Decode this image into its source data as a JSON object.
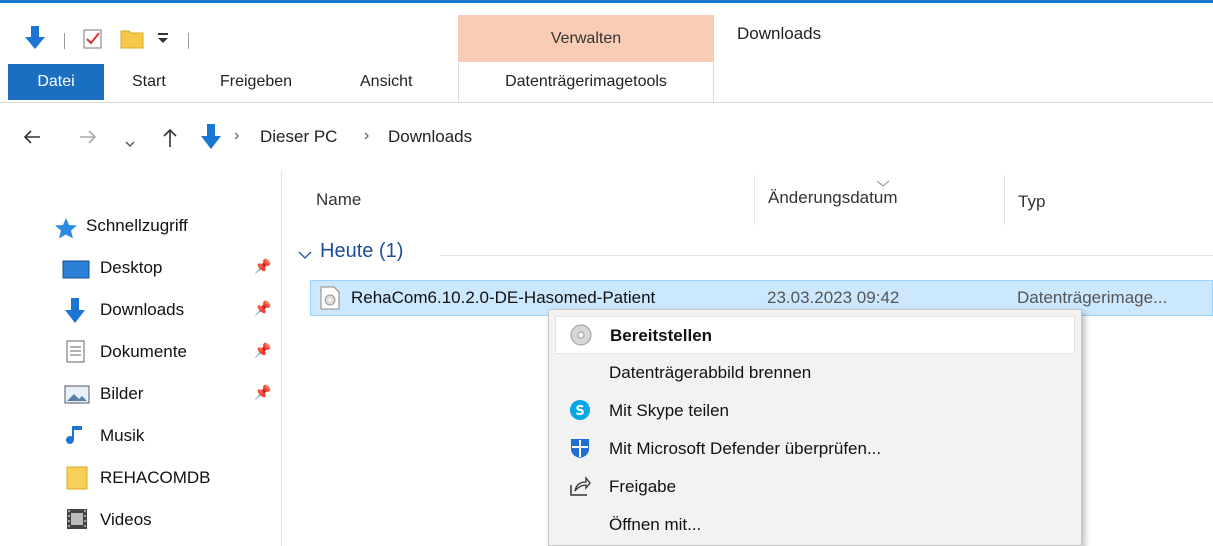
{
  "window": {
    "title": "Downloads"
  },
  "ribbon": {
    "contextual_group": "Verwalten",
    "tabs": {
      "datei": "Datei",
      "start": "Start",
      "freigeben": "Freigeben",
      "ansicht": "Ansicht",
      "datentraeger": "Datenträgerimagetools"
    }
  },
  "address": {
    "crumbs": [
      "Dieser PC",
      "Downloads"
    ]
  },
  "nav": {
    "quick_access": "Schnellzugriff",
    "items": [
      {
        "label": "Desktop",
        "icon": "desktop-icon",
        "pinned": true
      },
      {
        "label": "Downloads",
        "icon": "download-arrow-icon",
        "pinned": true
      },
      {
        "label": "Dokumente",
        "icon": "documents-icon",
        "pinned": true
      },
      {
        "label": "Bilder",
        "icon": "pictures-icon",
        "pinned": true
      },
      {
        "label": "Musik",
        "icon": "music-icon",
        "pinned": false
      },
      {
        "label": "REHACOMDB",
        "icon": "folder-icon",
        "pinned": false
      },
      {
        "label": "Videos",
        "icon": "videos-icon",
        "pinned": false
      }
    ]
  },
  "columns": {
    "name": "Name",
    "date": "Änderungsdatum",
    "type": "Typ"
  },
  "group": {
    "label": "Heute (1)"
  },
  "file": {
    "name": "RehaCom6.10.2.0-DE-Hasomed-Patient",
    "date": "23.03.2023 09:42",
    "type": "Datenträgerimage..."
  },
  "context_menu": {
    "items": [
      {
        "label": "Bereitstellen",
        "icon": "disc-icon"
      },
      {
        "label": "Datenträgerabbild brennen",
        "icon": ""
      },
      {
        "label": "Mit Skype teilen",
        "icon": "skype-icon"
      },
      {
        "label": "Mit Microsoft Defender überprüfen...",
        "icon": "defender-shield-icon"
      },
      {
        "label": "Freigabe",
        "icon": "share-icon"
      },
      {
        "label": "Öffnen mit...",
        "icon": ""
      }
    ]
  },
  "colors": {
    "accent": "#1a6fc0",
    "contextual_tab": "#f9cdb5",
    "selection": "#cce8ff",
    "group_text": "#1e4e9a"
  }
}
